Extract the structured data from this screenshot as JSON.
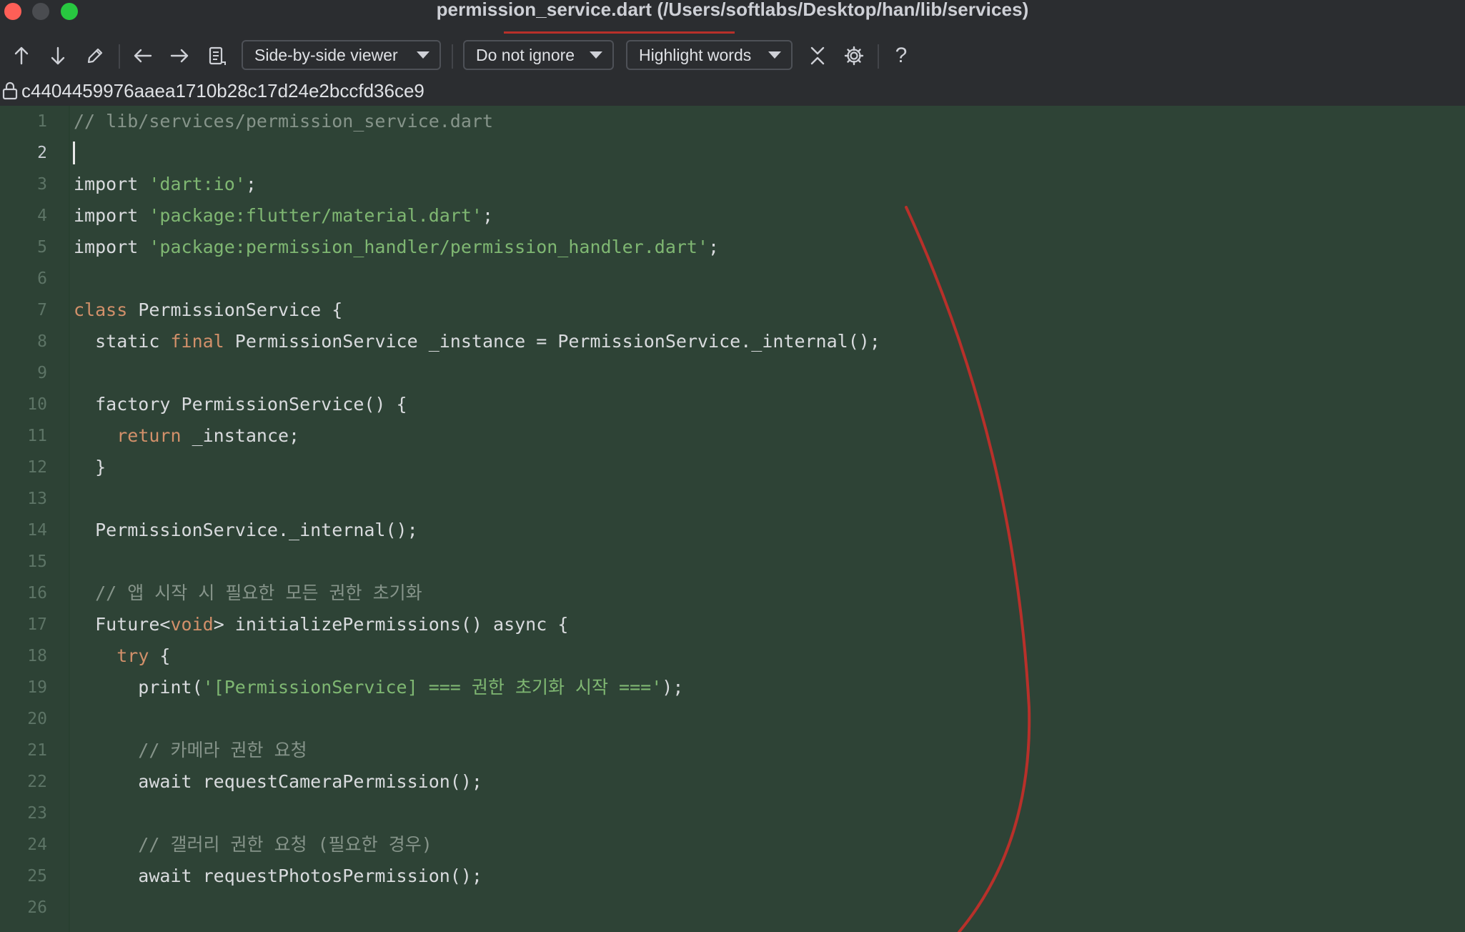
{
  "window": {
    "title": "permission_service.dart (/Users/softlabs/Desktop/han/lib/services)"
  },
  "toolbar": {
    "viewer_mode": "Side-by-side viewer",
    "ignore_mode": "Do not ignore",
    "highlight_mode": "Highlight words",
    "help_label": "?"
  },
  "revision": {
    "hash": "c4404459976aaea1710b28c17d24e2bccfd36ce9"
  },
  "editor": {
    "current_line": 2,
    "lines": [
      {
        "n": "1",
        "tokens": [
          {
            "t": "// lib/services/permission_service.dart",
            "c": "cmt"
          }
        ]
      },
      {
        "n": "2",
        "tokens": []
      },
      {
        "n": "3",
        "tokens": [
          {
            "t": "import ",
            "c": ""
          },
          {
            "t": "'dart:io'",
            "c": "str"
          },
          {
            "t": ";",
            "c": ""
          }
        ]
      },
      {
        "n": "4",
        "tokens": [
          {
            "t": "import ",
            "c": ""
          },
          {
            "t": "'package:flutter/material.dart'",
            "c": "str"
          },
          {
            "t": ";",
            "c": ""
          }
        ]
      },
      {
        "n": "5",
        "tokens": [
          {
            "t": "import ",
            "c": ""
          },
          {
            "t": "'package:permission_handler/permission_handler.dart'",
            "c": "str"
          },
          {
            "t": ";",
            "c": ""
          }
        ]
      },
      {
        "n": "6",
        "tokens": []
      },
      {
        "n": "7",
        "tokens": [
          {
            "t": "class",
            "c": "kw"
          },
          {
            "t": " PermissionService {",
            "c": ""
          }
        ]
      },
      {
        "n": "8",
        "tokens": [
          {
            "t": "  static ",
            "c": ""
          },
          {
            "t": "final",
            "c": "kw"
          },
          {
            "t": " PermissionService _instance = PermissionService._internal();",
            "c": ""
          }
        ]
      },
      {
        "n": "9",
        "tokens": []
      },
      {
        "n": "10",
        "tokens": [
          {
            "t": "  factory PermissionService() {",
            "c": ""
          }
        ]
      },
      {
        "n": "11",
        "tokens": [
          {
            "t": "    ",
            "c": ""
          },
          {
            "t": "return",
            "c": "kw"
          },
          {
            "t": " _instance;",
            "c": ""
          }
        ]
      },
      {
        "n": "12",
        "tokens": [
          {
            "t": "  }",
            "c": ""
          }
        ]
      },
      {
        "n": "13",
        "tokens": []
      },
      {
        "n": "14",
        "tokens": [
          {
            "t": "  PermissionService._internal();",
            "c": ""
          }
        ]
      },
      {
        "n": "15",
        "tokens": []
      },
      {
        "n": "16",
        "tokens": [
          {
            "t": "  // 앱 시작 시 필요한 모든 권한 초기화",
            "c": "cmt"
          }
        ]
      },
      {
        "n": "17",
        "tokens": [
          {
            "t": "  Future<",
            "c": ""
          },
          {
            "t": "void",
            "c": "kw"
          },
          {
            "t": "> initializePermissions() async {",
            "c": ""
          }
        ]
      },
      {
        "n": "18",
        "tokens": [
          {
            "t": "    ",
            "c": ""
          },
          {
            "t": "try",
            "c": "kw"
          },
          {
            "t": " {",
            "c": ""
          }
        ]
      },
      {
        "n": "19",
        "tokens": [
          {
            "t": "      print(",
            "c": ""
          },
          {
            "t": "'[PermissionService] === 권한 초기화 시작 ==='",
            "c": "str"
          },
          {
            "t": ");",
            "c": ""
          }
        ]
      },
      {
        "n": "20",
        "tokens": []
      },
      {
        "n": "21",
        "tokens": [
          {
            "t": "      // 카메라 권한 요청",
            "c": "cmt"
          }
        ]
      },
      {
        "n": "22",
        "tokens": [
          {
            "t": "      await requestCameraPermission();",
            "c": ""
          }
        ]
      },
      {
        "n": "23",
        "tokens": []
      },
      {
        "n": "24",
        "tokens": [
          {
            "t": "      // 갤러리 권한 요청 (필요한 경우)",
            "c": "cmt"
          }
        ]
      },
      {
        "n": "25",
        "tokens": [
          {
            "t": "      await requestPhotosPermission();",
            "c": ""
          }
        ]
      },
      {
        "n": "26",
        "tokens": []
      }
    ]
  },
  "colors": {
    "comment": "#86948a",
    "keyword": "#d2906a",
    "string": "#7fb772",
    "added_background": "#2e4336",
    "annotation_stroke": "#b8302a"
  },
  "icons": {
    "toolbar": [
      "arrow-up-icon",
      "arrow-down-icon",
      "pencil-icon",
      "arrow-left-icon",
      "arrow-right-icon",
      "document-icon",
      "collapse-icon",
      "gear-icon",
      "help-icon"
    ],
    "hash_bar": "lock-icon"
  }
}
